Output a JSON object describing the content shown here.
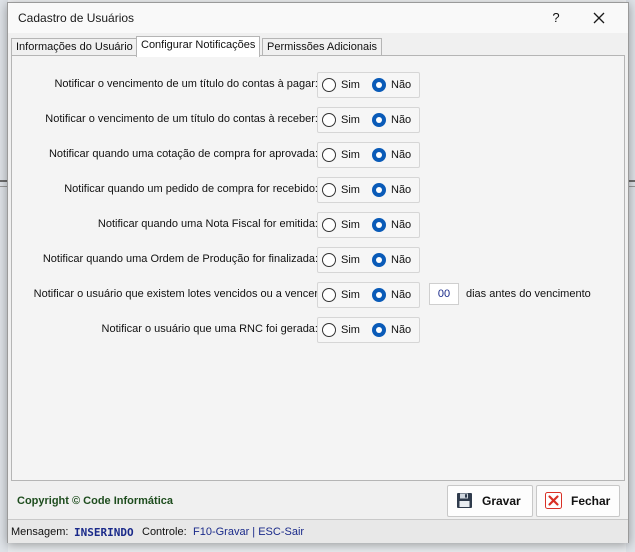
{
  "window": {
    "title": "Cadastro de Usuários",
    "help_label": "?",
    "close_icon": "close-icon"
  },
  "tabs": [
    {
      "label": "Informações do Usuário",
      "active": false
    },
    {
      "label": "Configurar Notificações",
      "active": true
    },
    {
      "label": "Permissões Adicionais",
      "active": false
    }
  ],
  "options": {
    "yes": "Sim",
    "no": "Não"
  },
  "notifications": [
    {
      "label": "Notificar o vencimento de um título do contas à pagar:",
      "selected": "Não"
    },
    {
      "label": "Notificar o vencimento de um título do contas à receber:",
      "selected": "Não"
    },
    {
      "label": "Notificar quando uma cotação de compra for aprovada:",
      "selected": "Não"
    },
    {
      "label": "Notificar quando um pedido de compra for recebido:",
      "selected": "Não"
    },
    {
      "label": "Notificar quando uma Nota Fiscal for emitida:",
      "selected": "Não"
    },
    {
      "label": "Notificar quando uma Ordem de Produção for finalizada:",
      "selected": "Não"
    },
    {
      "label": "Notificar o usuário que existem lotes vencidos ou a vencer",
      "selected": "Não",
      "days_value": "00",
      "days_label": "dias antes do vencimento"
    },
    {
      "label": "Notificar o usuário que uma RNC foi gerada:",
      "selected": "Não"
    }
  ],
  "footer": {
    "copyright": "Copyright © Code Informática",
    "save_label": "Gravar",
    "close_label": "Fechar"
  },
  "statusbar": {
    "message_label": "Mensagem:",
    "message_value": "INSERINDO",
    "control_label": "Controle:",
    "control_value": "F10-Gravar | ESC-Sair"
  },
  "colors": {
    "accent": "#0a5bb8",
    "copyright": "#1e4d1e",
    "status_value": "#1a2a8a",
    "close_icon_red": "#d93025"
  }
}
